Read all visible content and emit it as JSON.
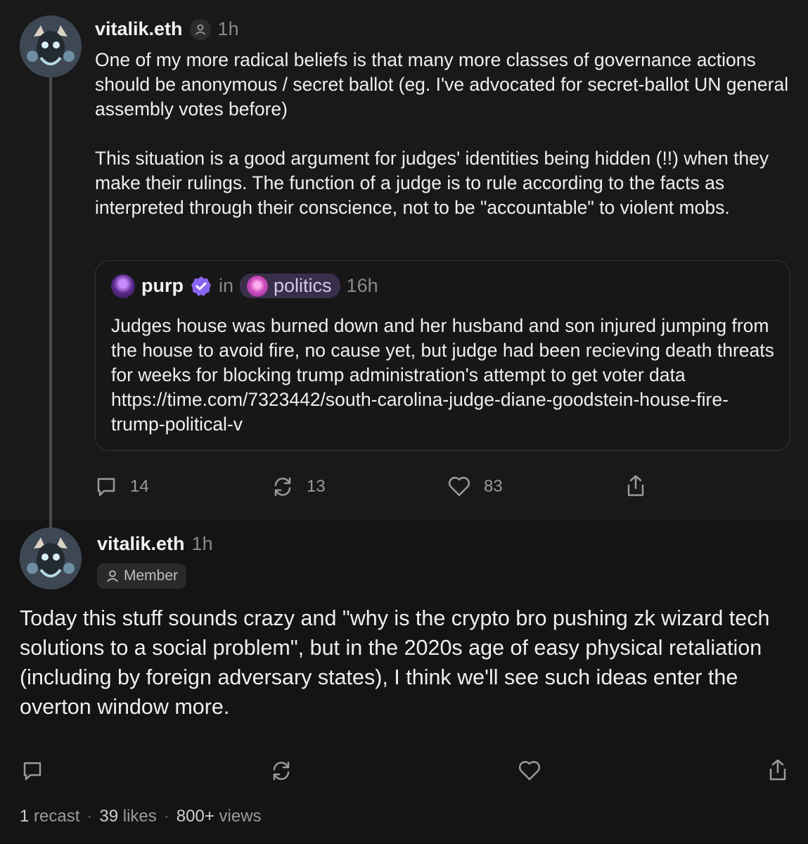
{
  "post": {
    "author": "vitalik.eth",
    "time": "1h",
    "text": "One of my more radical beliefs is that many more classes of governance actions should be anonymous / secret ballot (eg. I've advocated for secret-ballot UN general assembly votes before)\n\nThis situation is a good argument for judges' identities being hidden (!!) when they make their rulings. The function of a judge is to rule according to the facts as interpreted through their conscience, not to be \"accountable\" to violent mobs.",
    "quote": {
      "author": "purp",
      "in_label": "in",
      "channel": "politics",
      "time": "16h",
      "text": "Judges house was burned down and her husband and son injured jumping from the house to avoid fire, no cause yet, but judge had been recieving death threats for weeks for blocking trump administration's attempt to get voter data https://time.com/7323442/south-carolina-judge-diane-goodstein-house-fire-trump-political-v"
    },
    "replies": "14",
    "recasts": "13",
    "likes": "83"
  },
  "reply": {
    "author": "vitalik.eth",
    "time": "1h",
    "badge": "Member",
    "text": "Today this stuff sounds crazy and \"why is the crypto bro pushing zk wizard tech solutions to a social problem\", but in the 2020s age of easy physical retaliation (including by foreign adversary states), I think we'll see such ideas enter the overton window more.",
    "stats": {
      "recast_count": "1",
      "recast_label": "recast",
      "likes_count": "39",
      "likes_label": "likes",
      "views_count": "800+",
      "views_label": "views",
      "separator": "·"
    }
  },
  "icons": {
    "reply": "comment-icon",
    "recast": "recast-icon",
    "like": "heart-icon",
    "share": "share-icon",
    "member": "person-icon",
    "verified": "verified-badge-icon"
  },
  "colors": {
    "background": "#141414",
    "post_background": "#191919",
    "text": "#ececec",
    "muted": "#8a8a8a",
    "verified": "#8a63f2",
    "channel_bg": "#3a2f4a"
  }
}
